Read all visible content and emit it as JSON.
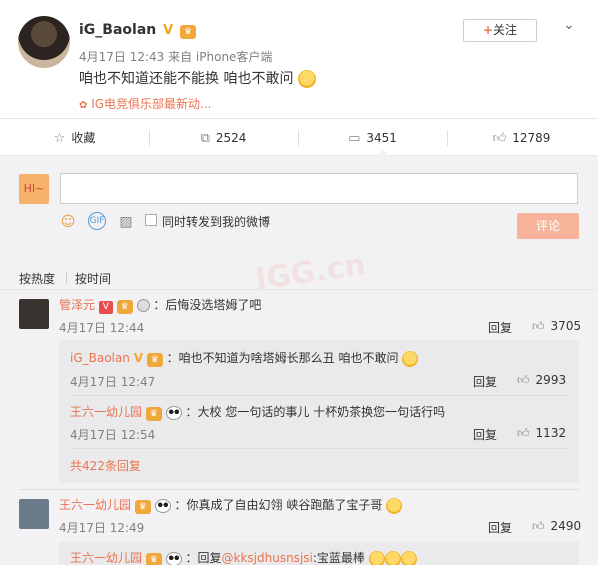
{
  "post": {
    "username": "iG_Baolan",
    "follow_label": "关注",
    "meta": "4月17日 12:43 来自 iPhone客户端",
    "text": "咱也不知道还能不能换 咱也不敢问",
    "source": "IG电竞俱乐部最新动..."
  },
  "actions": {
    "favorite": "收藏",
    "repost_count": "2524",
    "comment_count": "3451",
    "like_count": "12789"
  },
  "composer": {
    "avatar_text": "HI~",
    "placeholder": "",
    "repost_label": "同时转发到我的微博",
    "submit_label": "评论"
  },
  "sort": {
    "hot": "按热度",
    "time": "按时间"
  },
  "watermark": "IGG.cn",
  "comments": [
    {
      "name": "管泽元",
      "text": "：后悔没选塔姆了吧",
      "time": "4月17日 12:44",
      "reply": "回复",
      "likes": "3705",
      "replies": [
        {
          "name": "iG_Baolan",
          "text": "：咱也不知道为啥塔姆长那么丑 咱也不敢问",
          "time": "4月17日 12:47",
          "reply": "回复",
          "likes": "2993"
        },
        {
          "name": "王六一幼儿园",
          "text": "：大校 您一句话的事儿 十杯奶茶换您一句话行吗",
          "time": "4月17日 12:54",
          "reply": "回复",
          "likes": "1132"
        }
      ],
      "more_replies": "共422条回复"
    },
    {
      "name": "王六一幼儿园",
      "text": "：你真成了自由幻翎 峡谷跑酷了宝子哥",
      "time": "4月17日 12:49",
      "reply": "回复",
      "likes": "2490",
      "replies": [
        {
          "name": "王六一幼儿园",
          "text": "：回复",
          "mention": "@kksjdhusnsjsi",
          "text2": ":宝蓝最棒"
        }
      ]
    }
  ]
}
